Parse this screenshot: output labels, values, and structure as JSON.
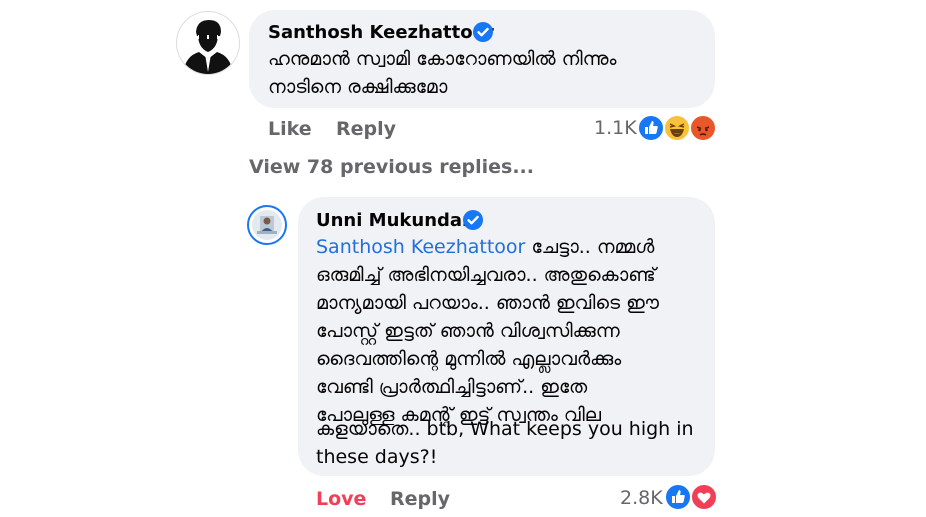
{
  "comment": {
    "author": "Santhosh Keezhattoor",
    "text_lines": [
      "ഹനുമാൻ സ്വാമി കോറോണയിൽ നിന്നും",
      "നാടിനെ രക്ഷിക്കുമോ"
    ],
    "actions": {
      "like": "Like",
      "reply": "Reply"
    },
    "reaction_count": "1.1K",
    "reactions": [
      "like-icon",
      "haha-icon",
      "angry-icon"
    ]
  },
  "view_replies": "View 78 previous replies...",
  "reply": {
    "author": "Unni Mukundan",
    "mention": "Santhosh Keezhattoor",
    "first_line_rest": " ചേട്ടാ.. നമ്മൾ",
    "text_lines": [
      "ഒരുമിച്ച് അഭിനയിച്ചവരാ.. അതുകൊണ്ട്",
      "മാന്യമായി പറയാം.. ഞാൻ ഇവിടെ ഈ",
      "പോസ്റ്റ് ഇട്ടത് ഞാൻ വിശ്വസിക്കുന്ന",
      "ദൈവത്തിന്റെ മുന്നിൽ എല്ലാവർക്കും",
      "വേണ്ടി പ്രാർത്ഥിച്ചിട്ടാണ്.. ഇതേ",
      "പോലുള്ള കമന്റ് ഇട്ട് സ്വന്തം വില",
      "കളയാതെ.. btb, What keeps you high in",
      "these days?!"
    ],
    "actions": {
      "love": "Love",
      "reply": "Reply"
    },
    "reaction_count": "2.8K",
    "reactions": [
      "like-icon",
      "love-icon"
    ]
  },
  "colors": {
    "bubble": "#f0f2f5",
    "mention": "#216fdb",
    "meta": "#65676b",
    "love": "#f33e58",
    "verified": "#1877f2"
  }
}
